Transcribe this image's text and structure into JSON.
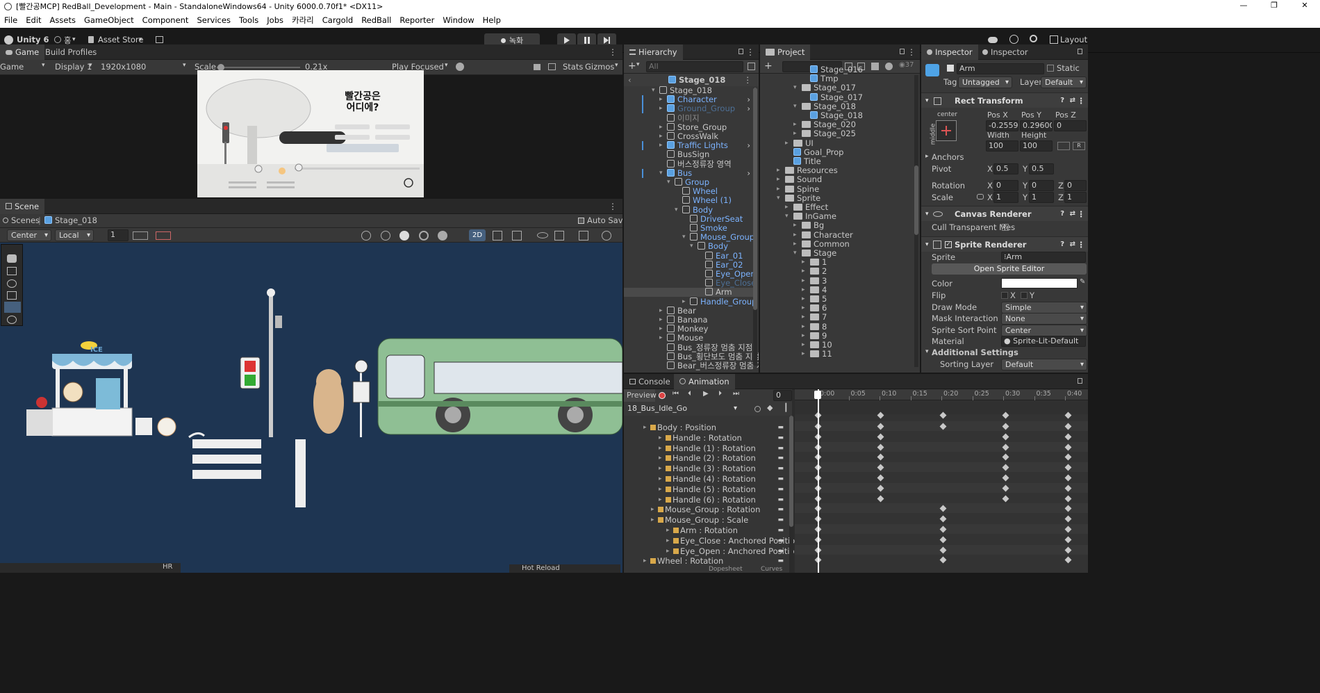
{
  "window": {
    "title": "[빨간공MCP] RedBall_Development - Main - StandaloneWindows64 - Unity 6000.0.70f1* <DX11>",
    "controls": [
      "—",
      "❐",
      "✕"
    ]
  },
  "menu": [
    "File",
    "Edit",
    "Assets",
    "GameObject",
    "Component",
    "Services",
    "Tools",
    "Jobs",
    "카라리",
    "Cargold",
    "RedBall",
    "Reporter",
    "Window",
    "Help"
  ],
  "toolbar": {
    "unity_label": "Unity 6",
    "account_label": "홍",
    "store_label": "Asset Store",
    "record_label": "녹화",
    "layout_label": "Layout"
  },
  "game": {
    "tab_game": "Game",
    "tab_build": "Build Profiles",
    "mode": "Game",
    "display": "Display 1",
    "resolution": "1920x1080",
    "scale_label": "Scale",
    "scale_value": "0.21x",
    "scale_fraction": 0.05,
    "play_mode": "Play Focused",
    "stats": "Stats",
    "gizmos": "Gizmos",
    "game_title": "빨간공은\n어디에?"
  },
  "scene": {
    "tab": "Scene",
    "breadcrumb_root": "Scenes",
    "breadcrumb_stage": "Stage_018",
    "auto_save": "Auto Save",
    "pivot": "Center",
    "space": "Local",
    "grid_value": "1",
    "mode_2d": "2D",
    "ice_label": "ICE",
    "hot_reload": "Hot Reload",
    "hr_label": "HR"
  },
  "hierarchy": {
    "tab": "Hierarchy",
    "search_placeholder": "All",
    "scene_name": "Stage_018",
    "rows": [
      {
        "label": "Stage_018",
        "indent": 0,
        "type": "cube",
        "expanded": true,
        "color": "normal"
      },
      {
        "label": "Character",
        "indent": 1,
        "type": "cubeblue",
        "expanded": false,
        "color": "blue",
        "more": true
      },
      {
        "label": "Ground_Group",
        "indent": 1,
        "type": "cubeblue",
        "expanded": false,
        "color": "dimblue",
        "more": true
      },
      {
        "label": "이미지",
        "indent": 1,
        "type": "cube",
        "expanded": null,
        "color": "dim"
      },
      {
        "label": "Store_Group",
        "indent": 1,
        "type": "cube",
        "expanded": false,
        "color": "normal"
      },
      {
        "label": "CrossWalk",
        "indent": 1,
        "type": "cube",
        "expanded": false,
        "color": "normal"
      },
      {
        "label": "Traffic Lights",
        "indent": 1,
        "type": "cubeblue",
        "expanded": false,
        "color": "blue",
        "more": true
      },
      {
        "label": "BusSign",
        "indent": 1,
        "type": "cube",
        "expanded": null,
        "color": "normal"
      },
      {
        "label": "버스정류장 영역",
        "indent": 1,
        "type": "cube",
        "expanded": null,
        "color": "normal"
      },
      {
        "label": "Bus",
        "indent": 1,
        "type": "cubeblue",
        "expanded": true,
        "color": "blue",
        "more": true
      },
      {
        "label": "Group",
        "indent": 2,
        "type": "cube",
        "expanded": true,
        "color": "blue"
      },
      {
        "label": "Wheel",
        "indent": 3,
        "type": "cube",
        "expanded": null,
        "color": "blue"
      },
      {
        "label": "Wheel (1)",
        "indent": 3,
        "type": "cube",
        "expanded": null,
        "color": "blue"
      },
      {
        "label": "Body",
        "indent": 3,
        "type": "cube",
        "expanded": true,
        "color": "blue"
      },
      {
        "label": "DriverSeat",
        "indent": 4,
        "type": "cube",
        "expanded": null,
        "color": "blue"
      },
      {
        "label": "Smoke",
        "indent": 4,
        "type": "cube",
        "expanded": null,
        "color": "blue"
      },
      {
        "label": "Mouse_Group",
        "indent": 4,
        "type": "cube",
        "expanded": true,
        "color": "blue"
      },
      {
        "label": "Body",
        "indent": 5,
        "type": "cube",
        "expanded": true,
        "color": "blue"
      },
      {
        "label": "Ear_01",
        "indent": 6,
        "type": "cube",
        "expanded": null,
        "color": "blue"
      },
      {
        "label": "Ear_02",
        "indent": 6,
        "type": "cube",
        "expanded": null,
        "color": "blue"
      },
      {
        "label": "Eye_Open",
        "indent": 6,
        "type": "cube",
        "expanded": null,
        "color": "blue"
      },
      {
        "label": "Eye_Close",
        "indent": 6,
        "type": "cube",
        "expanded": null,
        "color": "dimblue"
      },
      {
        "label": "Arm",
        "indent": 6,
        "type": "cube",
        "expanded": null,
        "color": "normal",
        "selected": true
      },
      {
        "label": "Handle_Group",
        "indent": 4,
        "type": "cube",
        "expanded": false,
        "color": "blue"
      },
      {
        "label": "Bear",
        "indent": 1,
        "type": "cube",
        "expanded": false,
        "color": "normal"
      },
      {
        "label": "Banana",
        "indent": 1,
        "type": "cube",
        "expanded": false,
        "color": "normal"
      },
      {
        "label": "Monkey",
        "indent": 1,
        "type": "cube",
        "expanded": false,
        "color": "normal"
      },
      {
        "label": "Mouse",
        "indent": 1,
        "type": "cube",
        "expanded": false,
        "color": "normal"
      },
      {
        "label": "Bus_정류장 멈춤 지점",
        "indent": 1,
        "type": "cube",
        "expanded": null,
        "color": "normal"
      },
      {
        "label": "Bus_횡단보도 멈춤 지점",
        "indent": 1,
        "type": "cube",
        "expanded": null,
        "color": "normal"
      },
      {
        "label": "Bear_버스정류장 멈춤 지",
        "indent": 1,
        "type": "cube",
        "expanded": null,
        "color": "normal"
      }
    ]
  },
  "project": {
    "tab": "Project",
    "count": "37",
    "rows": [
      {
        "label": "Stage_016",
        "indent": 3,
        "type": "cubeblue",
        "cut": true
      },
      {
        "label": "Tmp",
        "indent": 3,
        "type": "cubeblue"
      },
      {
        "label": "Stage_017",
        "indent": 2,
        "type": "folder",
        "expanded": true
      },
      {
        "label": "Stage_017",
        "indent": 3,
        "type": "cubeblue"
      },
      {
        "label": "Stage_018",
        "indent": 2,
        "type": "folder",
        "expanded": true
      },
      {
        "label": "Stage_018",
        "indent": 3,
        "type": "cubeblue"
      },
      {
        "label": "Stage_020",
        "indent": 2,
        "type": "folder",
        "expanded": false
      },
      {
        "label": "Stage_025",
        "indent": 2,
        "type": "folder",
        "expanded": false
      },
      {
        "label": "UI",
        "indent": 1,
        "type": "folder",
        "expanded": false
      },
      {
        "label": "Goal_Prop",
        "indent": 1,
        "type": "cubeblue"
      },
      {
        "label": "Title",
        "indent": 1,
        "type": "cubeblue"
      },
      {
        "label": "Resources",
        "indent": 0,
        "type": "folder",
        "expanded": false
      },
      {
        "label": "Sound",
        "indent": 0,
        "type": "folder",
        "expanded": false
      },
      {
        "label": "Spine",
        "indent": 0,
        "type": "folder",
        "expanded": false
      },
      {
        "label": "Sprite",
        "indent": 0,
        "type": "folder",
        "expanded": true
      },
      {
        "label": "Effect",
        "indent": 1,
        "type": "folder",
        "expanded": false
      },
      {
        "label": "InGame",
        "indent": 1,
        "type": "folder",
        "expanded": true
      },
      {
        "label": "Bg",
        "indent": 2,
        "type": "folder",
        "expanded": false
      },
      {
        "label": "Character",
        "indent": 2,
        "type": "folder",
        "expanded": false
      },
      {
        "label": "Common",
        "indent": 2,
        "type": "folder",
        "expanded": false
      },
      {
        "label": "Stage",
        "indent": 2,
        "type": "folder",
        "expanded": true
      },
      {
        "label": "1",
        "indent": 3,
        "type": "folder",
        "expanded": false
      },
      {
        "label": "2",
        "indent": 3,
        "type": "folder",
        "expanded": false
      },
      {
        "label": "3",
        "indent": 3,
        "type": "folder",
        "expanded": false
      },
      {
        "label": "4",
        "indent": 3,
        "type": "folder",
        "expanded": false
      },
      {
        "label": "5",
        "indent": 3,
        "type": "folder",
        "expanded": false
      },
      {
        "label": "6",
        "indent": 3,
        "type": "folder",
        "expanded": false
      },
      {
        "label": "7",
        "indent": 3,
        "type": "folder",
        "expanded": false
      },
      {
        "label": "8",
        "indent": 3,
        "type": "folder",
        "expanded": false
      },
      {
        "label": "9",
        "indent": 3,
        "type": "folder",
        "expanded": false
      },
      {
        "label": "10",
        "indent": 3,
        "type": "folder",
        "expanded": false
      },
      {
        "label": "11",
        "indent": 3,
        "type": "folder",
        "expanded": false
      }
    ]
  },
  "inspector": {
    "tab1": "Inspector",
    "tab2": "Inspector",
    "name": "Arm",
    "static_label": "Static",
    "tag_label": "Tag",
    "tag_value": "Untagged",
    "layer_label": "Layer",
    "layer_value": "Default",
    "rect": {
      "title": "Rect Transform",
      "anchor_h": "center",
      "anchor_v": "middle",
      "posx_label": "Pos X",
      "posy_label": "Pos Y",
      "posz_label": "Pos Z",
      "posx": "-0.25599",
      "posy": "0.296000",
      "posz": "0",
      "width_label": "Width",
      "height_label": "Height",
      "width": "100",
      "height": "100",
      "anchors": "Anchors",
      "pivot_label": "Pivot",
      "pivot_x": "0.5",
      "pivot_y": "0.5",
      "rotation_label": "Rotation",
      "rot_x": "0",
      "rot_y": "0",
      "rot_z": "0",
      "scale_label": "Scale",
      "scale_x": "1",
      "scale_y": "1",
      "scale_z": "1",
      "x": "X",
      "y": "Y",
      "z": "Z",
      "raw_label": "R"
    },
    "canvas": {
      "title": "Canvas Renderer",
      "cull_label": "Cull Transparent Mes"
    },
    "sprite": {
      "title": "Sprite Renderer",
      "sprite_label": "Sprite",
      "sprite_value": "Arm",
      "open_editor": "Open Sprite Editor",
      "color_label": "Color",
      "flip_label": "Flip",
      "draw_mode_label": "Draw Mode",
      "draw_mode": "Simple",
      "mask_label": "Mask Interaction",
      "mask_value": "None",
      "sort_point_label": "Sprite Sort Point",
      "sort_point": "Center",
      "material_label": "Material",
      "material_value": "Sprite-Lit-Default",
      "additional": "Additional Settings",
      "sorting_layer_label": "Sorting Layer",
      "sorting_layer": "Default"
    }
  },
  "console": {
    "tab": "Console"
  },
  "animation": {
    "tab": "Animation",
    "preview": "Preview",
    "frame": "0",
    "clip": "18_Bus_Idle_Go",
    "times": [
      "0:00",
      "0:05",
      "0:10",
      "0:15",
      "0:20",
      "0:25",
      "0:30",
      "0:35",
      "0:40"
    ],
    "tracks": [
      {
        "label": "Body : Position",
        "indent": 0,
        "kf": [
          0,
          1,
          2,
          3,
          4
        ]
      },
      {
        "label": "Handle : Rotation",
        "indent": 1,
        "kf": [
          0,
          1,
          3,
          4
        ]
      },
      {
        "label": "Handle (1) : Rotation",
        "indent": 1,
        "kf": [
          0,
          1,
          3,
          4
        ]
      },
      {
        "label": "Handle (2) : Rotation",
        "indent": 1,
        "kf": [
          0,
          1,
          3,
          4
        ]
      },
      {
        "label": "Handle (3) : Rotation",
        "indent": 1,
        "kf": [
          0,
          1,
          3,
          4
        ]
      },
      {
        "label": "Handle (4) : Rotation",
        "indent": 1,
        "kf": [
          0,
          1,
          3,
          4
        ]
      },
      {
        "label": "Handle (5) : Rotation",
        "indent": 1,
        "kf": [
          0,
          1,
          3,
          4
        ]
      },
      {
        "label": "Handle (6) : Rotation",
        "indent": 1,
        "kf": [
          0,
          1,
          3,
          4
        ]
      },
      {
        "label": "Mouse_Group : Rotation",
        "indent": 0.5,
        "kf": [
          0,
          2,
          4
        ]
      },
      {
        "label": "Mouse_Group : Scale",
        "indent": 0.5,
        "kf": [
          0,
          2,
          4
        ]
      },
      {
        "label": "Arm : Rotation",
        "indent": 1.5,
        "kf": [
          0,
          2,
          4
        ]
      },
      {
        "label": "Eye_Close : Anchored Position",
        "indent": 1.5,
        "kf": [
          0,
          2,
          4
        ]
      },
      {
        "label": "Eye_Open : Anchored Position",
        "indent": 1.5,
        "kf": [
          0,
          2,
          4
        ]
      },
      {
        "label": "Wheel : Rotation",
        "indent": 0,
        "kf": [
          0,
          2,
          4
        ]
      }
    ],
    "dopesheet": "Dopesheet",
    "curves": "Curves"
  }
}
